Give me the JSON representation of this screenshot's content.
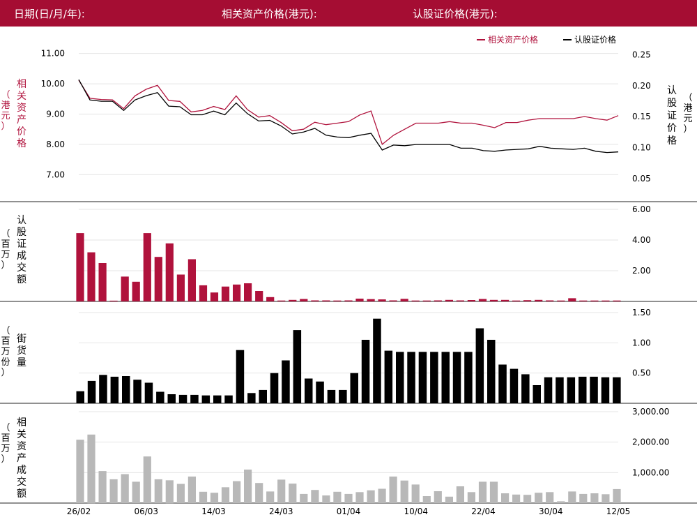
{
  "header": {
    "date_label": "日期(日/月/年):",
    "asset_price_label": "相关资产价格(港元):",
    "warrant_price_label": "认股证价格(港元):"
  },
  "colors": {
    "header_bg": "#a50d33",
    "asset": "#b0123c",
    "warrant": "#000000",
    "gray_bar": "#b8b8b8",
    "divider": "#222222",
    "grid": "#e4e4e4"
  },
  "chart_data": [
    {
      "type": "line",
      "legend": [
        "相关资产价格",
        "认股证价格"
      ],
      "legend_position": "top-right",
      "left_axis": {
        "label_chars": [
          "相",
          "关",
          "资",
          "产",
          "价",
          "格"
        ],
        "unit_chars": [
          "（",
          "港",
          "元",
          "）"
        ],
        "ticks": [
          "7.00",
          "8.00",
          "9.00",
          "10.00",
          "11.00"
        ],
        "ylim": [
          6.2,
          11.2
        ]
      },
      "right_axis": {
        "label_chars": [
          "认",
          "股",
          "证",
          "价",
          "格"
        ],
        "unit_chars": [
          "（",
          "港",
          "元",
          "）"
        ],
        "ticks": [
          "0.05",
          "0.10",
          "0.15",
          "0.20",
          "0.25"
        ],
        "ylim": [
          0.017,
          0.262
        ]
      },
      "series": [
        {
          "name": "相关资产价格",
          "axis": "left",
          "color": "#b0123c",
          "values": [
            10.12,
            9.52,
            9.48,
            9.47,
            9.18,
            9.6,
            9.82,
            9.95,
            9.45,
            9.42,
            9.07,
            9.12,
            9.25,
            9.15,
            9.6,
            9.15,
            8.9,
            8.95,
            8.72,
            8.45,
            8.5,
            8.73,
            8.65,
            8.7,
            8.75,
            8.97,
            9.1,
            8.0,
            8.3,
            8.5,
            8.7,
            8.7,
            8.7,
            8.75,
            8.7,
            8.7,
            8.63,
            8.55,
            8.72,
            8.72,
            8.8,
            8.85,
            8.85,
            8.85,
            8.85,
            8.92,
            8.85,
            8.8,
            8.95
          ]
        },
        {
          "name": "认股证价格",
          "axis": "right",
          "color": "#000000",
          "values": [
            0.21,
            0.177,
            0.175,
            0.175,
            0.16,
            0.177,
            0.184,
            0.189,
            0.167,
            0.166,
            0.153,
            0.153,
            0.159,
            0.153,
            0.172,
            0.155,
            0.143,
            0.144,
            0.135,
            0.122,
            0.125,
            0.131,
            0.12,
            0.117,
            0.116,
            0.12,
            0.123,
            0.096,
            0.104,
            0.103,
            0.105,
            0.105,
            0.105,
            0.105,
            0.099,
            0.099,
            0.095,
            0.094,
            0.096,
            0.097,
            0.098,
            0.102,
            0.099,
            0.098,
            0.097,
            0.099,
            0.094,
            0.092,
            0.093
          ]
        }
      ]
    },
    {
      "type": "bar",
      "label_chars": [
        "认",
        "股",
        "证",
        "成",
        "交",
        "额"
      ],
      "unit_chars": [
        "（",
        "百",
        "万",
        "）"
      ],
      "ticks": [
        "2.00",
        "4.00",
        "6.00"
      ],
      "ylim": [
        0,
        6.0
      ],
      "color": "#b0123c",
      "values": [
        4.45,
        3.2,
        2.5,
        0.05,
        1.62,
        1.28,
        4.45,
        2.9,
        3.78,
        1.75,
        2.75,
        1.05,
        0.58,
        0.97,
        1.1,
        1.18,
        0.68,
        0.28,
        0.06,
        0.1,
        0.16,
        0.07,
        0.07,
        0.06,
        0.07,
        0.18,
        0.15,
        0.13,
        0.07,
        0.17,
        0.06,
        0.06,
        0.07,
        0.1,
        0.07,
        0.09,
        0.16,
        0.1,
        0.1,
        0.06,
        0.08,
        0.1,
        0.07,
        0.06,
        0.21,
        0.06,
        0.06,
        0.06,
        0.06
      ]
    },
    {
      "type": "bar",
      "label_chars": [
        "街",
        "货",
        "量"
      ],
      "unit_chars": [
        "（",
        "百",
        "万",
        "份",
        "）"
      ],
      "ticks": [
        "0.50",
        "1.00",
        "1.50"
      ],
      "ylim": [
        0,
        1.5
      ],
      "color": "#000000",
      "values": [
        0.2,
        0.37,
        0.47,
        0.44,
        0.45,
        0.39,
        0.34,
        0.19,
        0.15,
        0.14,
        0.14,
        0.13,
        0.13,
        0.13,
        0.88,
        0.17,
        0.22,
        0.5,
        0.71,
        1.21,
        0.41,
        0.36,
        0.22,
        0.22,
        0.5,
        1.05,
        1.4,
        0.87,
        0.85,
        0.85,
        0.85,
        0.85,
        0.85,
        0.85,
        0.85,
        1.24,
        1.05,
        0.64,
        0.57,
        0.48,
        0.3,
        0.43,
        0.43,
        0.43,
        0.44,
        0.44,
        0.43,
        0.43
      ]
    },
    {
      "type": "bar",
      "label_chars": [
        "相",
        "关",
        "资",
        "产",
        "成",
        "交",
        "额"
      ],
      "unit_chars": [
        "（",
        "百",
        "万",
        "）"
      ],
      "ticks": [
        "1,000.00",
        "2,000.00",
        "3,000.00"
      ],
      "ylim": [
        0,
        3000
      ],
      "color": "#b8b8b8",
      "x_ticks": [
        "26/02",
        "06/03",
        "14/03",
        "24/03",
        "01/04",
        "10/04",
        "22/04",
        "30/04",
        "12/05"
      ],
      "values": [
        2080,
        2250,
        1050,
        780,
        950,
        700,
        1530,
        780,
        750,
        630,
        870,
        370,
        340,
        520,
        720,
        1100,
        660,
        380,
        770,
        640,
        300,
        430,
        250,
        370,
        300,
        360,
        420,
        470,
        870,
        740,
        610,
        230,
        390,
        210,
        550,
        360,
        700,
        700,
        320,
        280,
        270,
        340,
        360,
        60,
        380,
        300,
        320,
        290,
        460
      ]
    }
  ]
}
